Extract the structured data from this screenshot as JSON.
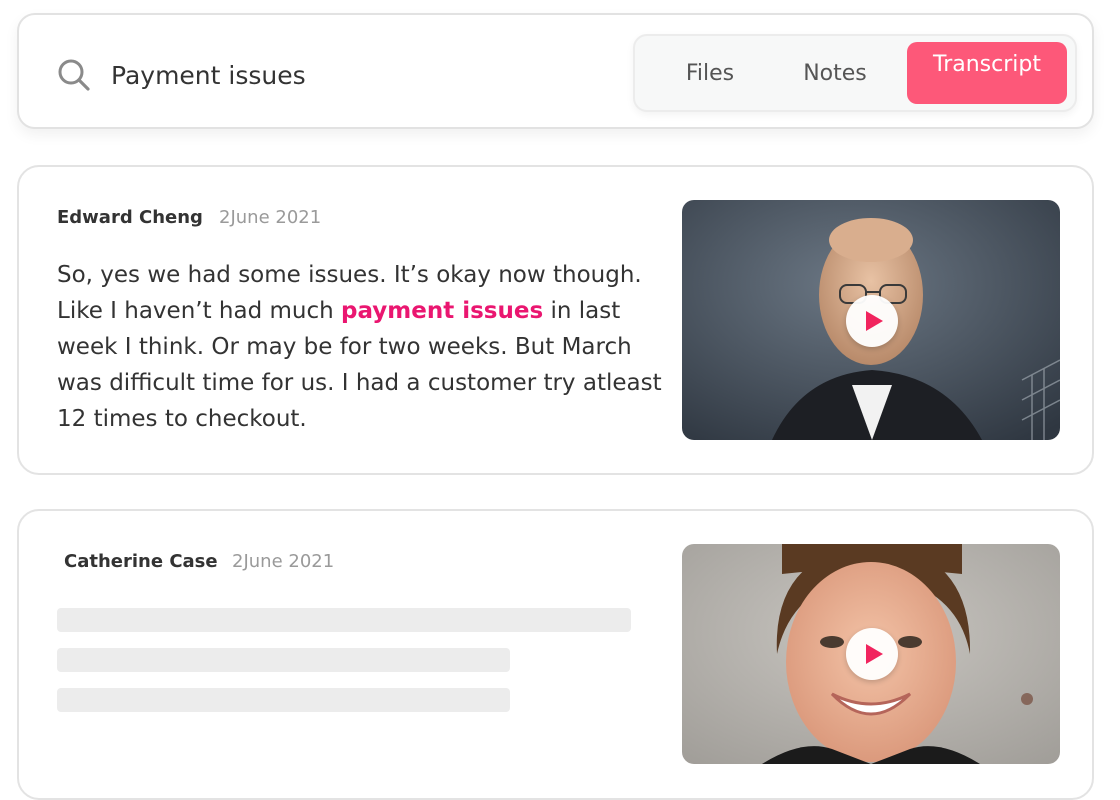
{
  "search": {
    "value": "Payment issues",
    "icon": "search-icon"
  },
  "tabs": [
    {
      "label": "Files",
      "active": false
    },
    {
      "label": "Notes",
      "active": false
    },
    {
      "label": "Transcript",
      "active": true
    }
  ],
  "colors": {
    "accent": "#fd5879",
    "highlight": "#ea1670",
    "play": "#f1245e"
  },
  "results": [
    {
      "author": "Edward Cheng",
      "date": "2June 2021",
      "transcript_before": "So, yes we had some issues. It’s okay now though. Like I haven’t had much ",
      "transcript_highlight": "payment issues",
      "transcript_after": " in last week I think. Or may be for two weeks. But March was difficult time for us. I had a customer try atleast 12 times to checkout.",
      "video_icon": "play-icon"
    },
    {
      "author": "Catherine Case",
      "date": "2June 2021",
      "loading": true,
      "video_icon": "play-icon"
    }
  ]
}
